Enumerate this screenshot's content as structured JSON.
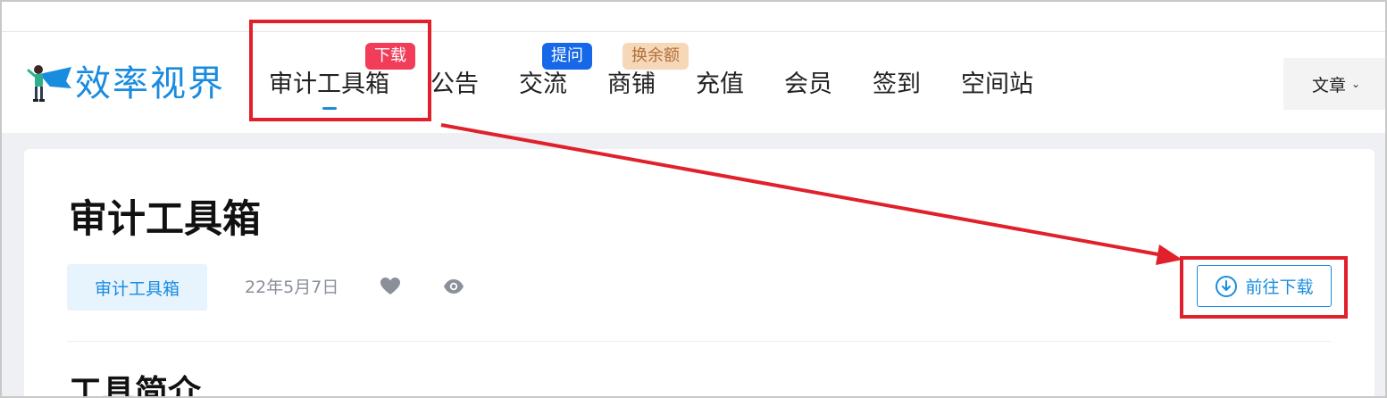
{
  "site": {
    "logo_text": "效率视界",
    "brand_color": "#1a8ce0"
  },
  "nav": {
    "items": [
      {
        "label": "审计工具箱",
        "badge": "下载",
        "badge_color": "#f23d5a"
      },
      {
        "label": "公告"
      },
      {
        "label": "交流",
        "badge": "提问",
        "badge_color": "#1668e8"
      },
      {
        "label": "商铺",
        "badge": "换余额",
        "badge_color": "#f6d8b8"
      },
      {
        "label": "充值"
      },
      {
        "label": "会员"
      },
      {
        "label": "签到"
      },
      {
        "label": "空间站"
      }
    ],
    "active_index": 0,
    "menu_label": "文章",
    "menu_icon": "chevron-down-icon"
  },
  "article": {
    "title": "审计工具箱",
    "tag": "审计工具箱",
    "date": "22年5月7日",
    "like_icon": "heart-icon",
    "view_icon": "eye-icon",
    "download_label": "前往下载",
    "download_icon": "cloud-download-icon",
    "section_title": "工具简介"
  },
  "annotation": {
    "highlight_color": "#e0202a"
  }
}
